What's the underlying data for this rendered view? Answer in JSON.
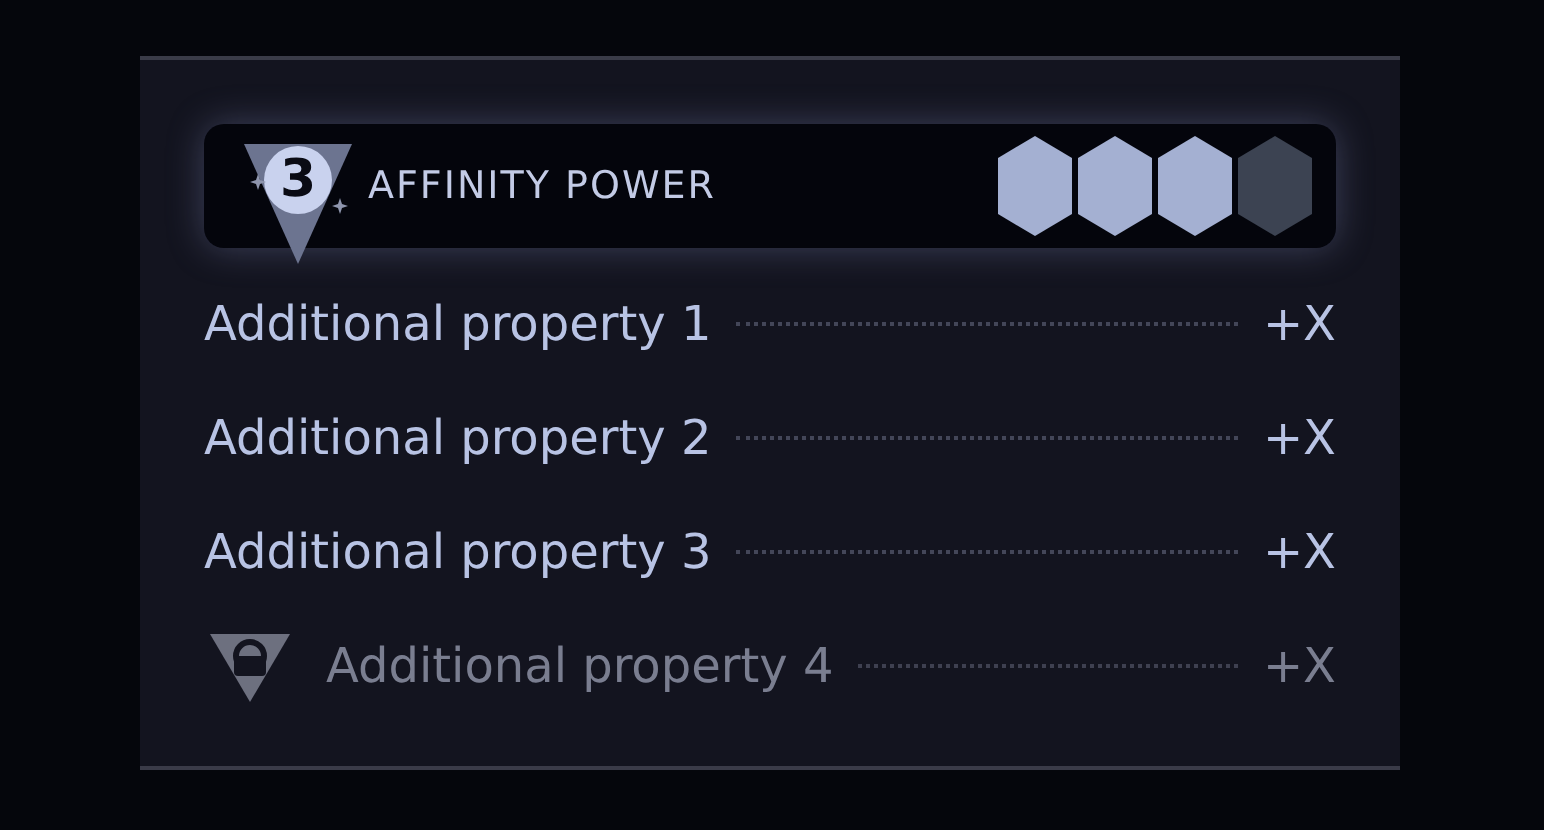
{
  "header": {
    "rank": "3",
    "title": "AFFINITY POWER",
    "pips": [
      {
        "on": true
      },
      {
        "on": true
      },
      {
        "on": true
      },
      {
        "on": false
      }
    ]
  },
  "properties": [
    {
      "label": "Additional property 1",
      "value": "+X",
      "locked": false
    },
    {
      "label": "Additional property 2",
      "value": "+X",
      "locked": false
    },
    {
      "label": "Additional property 3",
      "value": "+X",
      "locked": false
    },
    {
      "label": "Additional property 4",
      "value": "+X",
      "locked": true
    }
  ]
}
